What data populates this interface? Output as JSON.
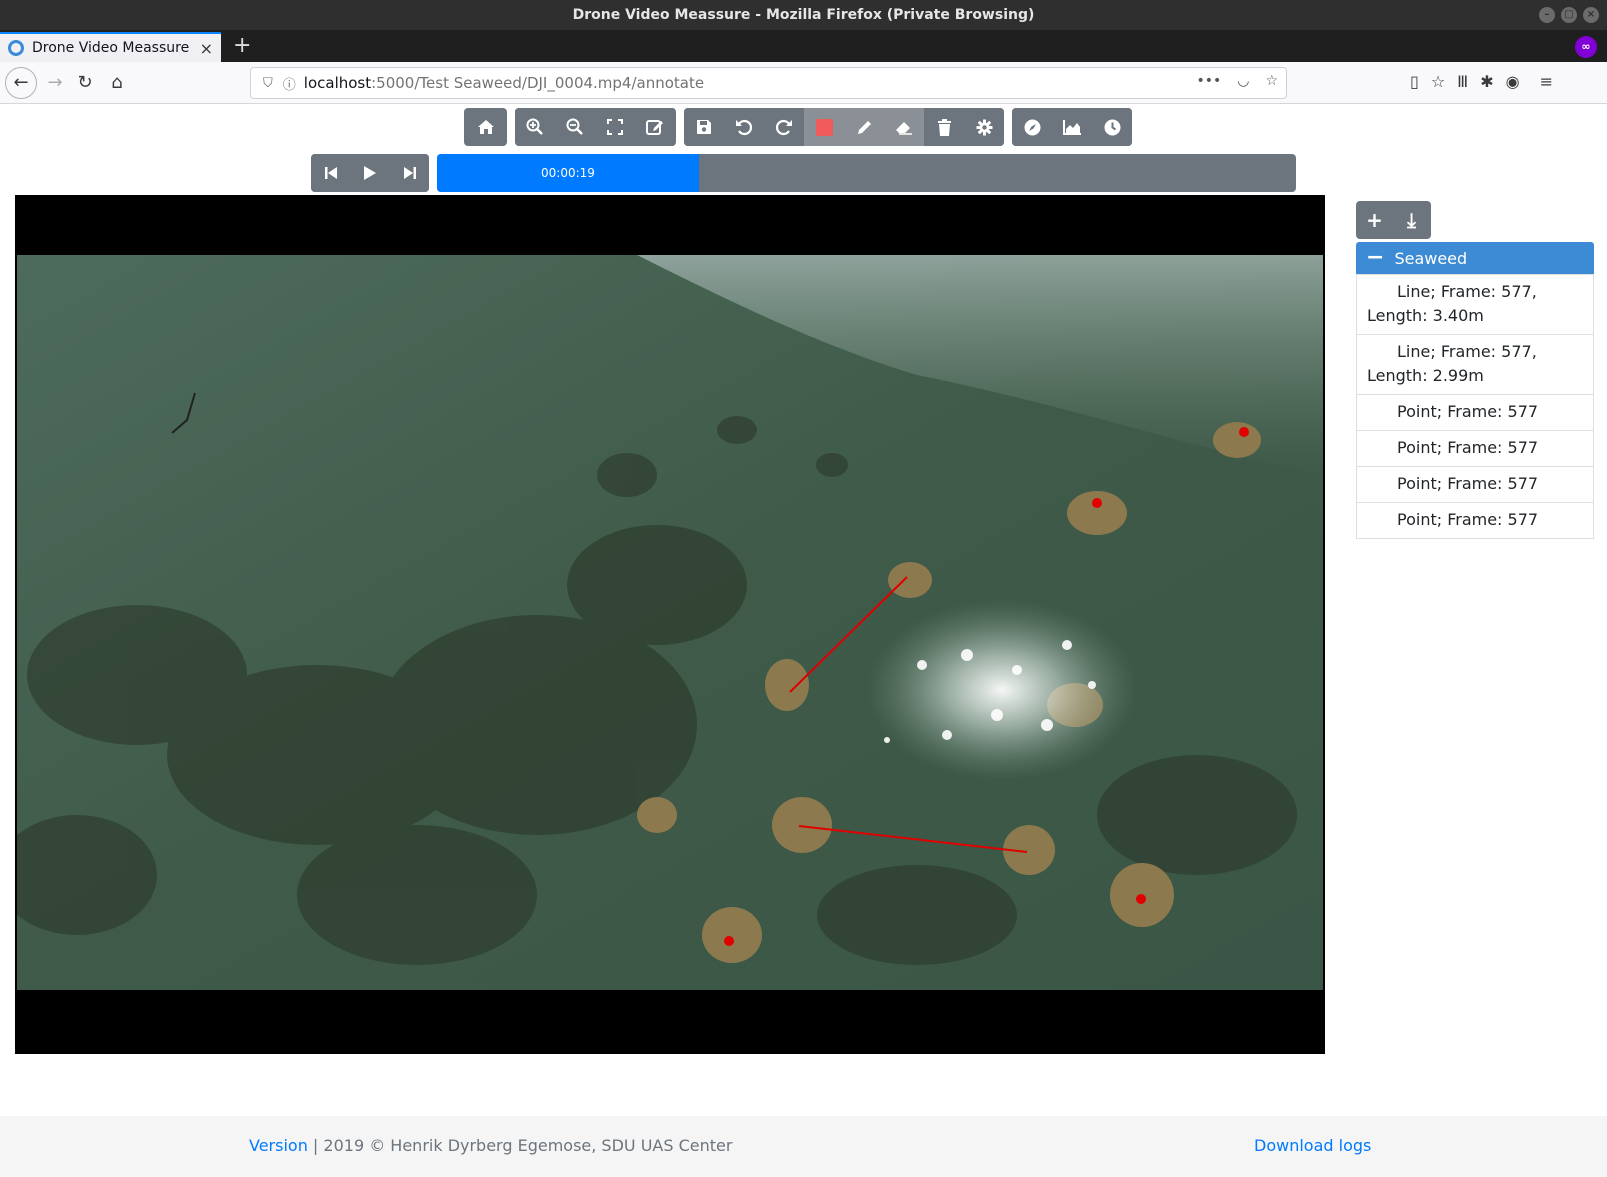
{
  "window": {
    "title": "Drone Video Meassure - Mozilla Firefox (Private Browsing)"
  },
  "browser": {
    "tab_title": "Drone Video Meassure",
    "url_host": "localhost",
    "url_rest": ":5000/Test Seaweed/DJI_0004.mp4/annotate"
  },
  "toolbar": {
    "groups": [
      [
        "home-icon"
      ],
      [
        "zoom-in-icon",
        "zoom-out-icon",
        "fullscreen-icon",
        "edit-icon"
      ],
      [
        "save-icon",
        "undo-icon",
        "redo-icon",
        "stop-icon",
        "pencil-icon",
        "eraser-icon",
        "trash-icon",
        "gear-icon"
      ],
      [
        "compass-icon",
        "chart-area-icon",
        "clock-icon"
      ]
    ],
    "active": [
      "stop-icon",
      "pencil-icon",
      "eraser-icon"
    ],
    "stop_color": "#f05a5a"
  },
  "player": {
    "time": "00:00:19",
    "progress_fraction": 0.305,
    "buttons": [
      "step-back-icon",
      "play-icon",
      "step-forward-icon"
    ]
  },
  "annotations": {
    "line_color": "#e00000",
    "point_color": "#e00000"
  },
  "panel": {
    "buttons": [
      "plus-icon",
      "import-icon"
    ],
    "group_name": "Seaweed",
    "items": [
      "Line; Frame: 577, Length: 3.40m",
      "Line; Frame: 577, Length: 2.99m",
      "Point; Frame: 577",
      "Point; Frame: 577",
      "Point; Frame: 577",
      "Point; Frame: 577"
    ]
  },
  "footer": {
    "version_link": "Version",
    "copyright": " | 2019 © Henrik Dyrberg Egemose, SDU UAS Center",
    "download_link": "Download logs"
  },
  "colors": {
    "accent": "#007bff",
    "secondary": "#6c757d",
    "group_header": "#3d8bd4"
  }
}
